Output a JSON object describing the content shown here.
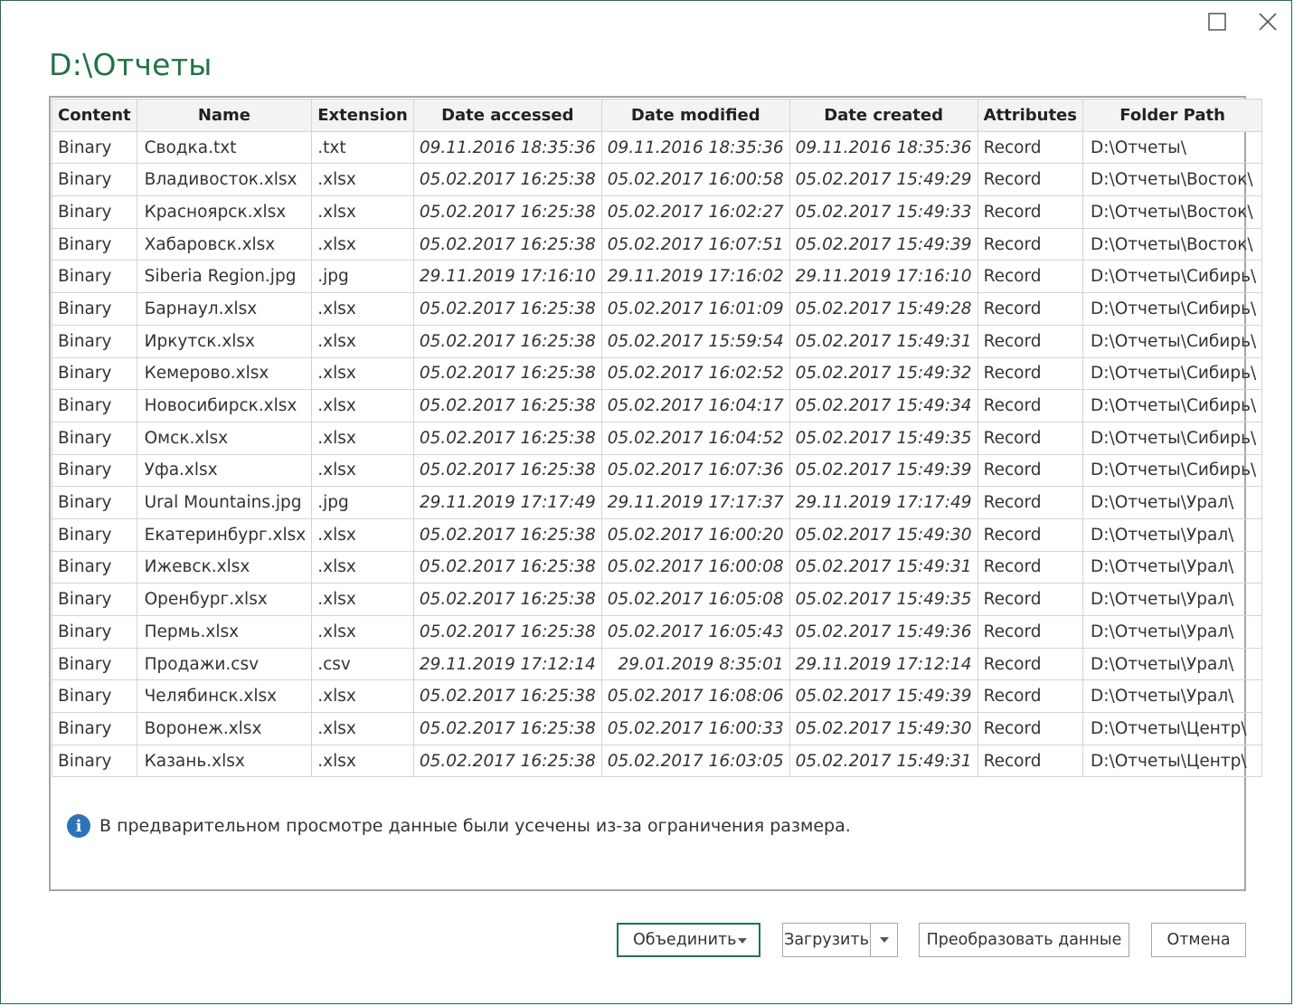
{
  "window": {
    "title": "D:\\Отчеты"
  },
  "table": {
    "columns": [
      "Content",
      "Name",
      "Extension",
      "Date accessed",
      "Date modified",
      "Date created",
      "Attributes",
      "Folder Path"
    ],
    "rows": [
      [
        "Binary",
        "Сводка.txt",
        ".txt",
        "09.11.2016 18:35:36",
        "09.11.2016 18:35:36",
        "09.11.2016 18:35:36",
        "Record",
        "D:\\Отчеты\\"
      ],
      [
        "Binary",
        "Владивосток.xlsx",
        ".xlsx",
        "05.02.2017 16:25:38",
        "05.02.2017 16:00:58",
        "05.02.2017 15:49:29",
        "Record",
        "D:\\Отчеты\\Восток\\"
      ],
      [
        "Binary",
        "Красноярск.xlsx",
        ".xlsx",
        "05.02.2017 16:25:38",
        "05.02.2017 16:02:27",
        "05.02.2017 15:49:33",
        "Record",
        "D:\\Отчеты\\Восток\\"
      ],
      [
        "Binary",
        "Хабаровск.xlsx",
        ".xlsx",
        "05.02.2017 16:25:38",
        "05.02.2017 16:07:51",
        "05.02.2017 15:49:39",
        "Record",
        "D:\\Отчеты\\Восток\\"
      ],
      [
        "Binary",
        "Siberia Region.jpg",
        ".jpg",
        "29.11.2019 17:16:10",
        "29.11.2019 17:16:02",
        "29.11.2019 17:16:10",
        "Record",
        "D:\\Отчеты\\Сибирь\\"
      ],
      [
        "Binary",
        "Барнаул.xlsx",
        ".xlsx",
        "05.02.2017 16:25:38",
        "05.02.2017 16:01:09",
        "05.02.2017 15:49:28",
        "Record",
        "D:\\Отчеты\\Сибирь\\"
      ],
      [
        "Binary",
        "Иркутск.xlsx",
        ".xlsx",
        "05.02.2017 16:25:38",
        "05.02.2017 15:59:54",
        "05.02.2017 15:49:31",
        "Record",
        "D:\\Отчеты\\Сибирь\\"
      ],
      [
        "Binary",
        "Кемерово.xlsx",
        ".xlsx",
        "05.02.2017 16:25:38",
        "05.02.2017 16:02:52",
        "05.02.2017 15:49:32",
        "Record",
        "D:\\Отчеты\\Сибирь\\"
      ],
      [
        "Binary",
        "Новосибирск.xlsx",
        ".xlsx",
        "05.02.2017 16:25:38",
        "05.02.2017 16:04:17",
        "05.02.2017 15:49:34",
        "Record",
        "D:\\Отчеты\\Сибирь\\"
      ],
      [
        "Binary",
        "Омск.xlsx",
        ".xlsx",
        "05.02.2017 16:25:38",
        "05.02.2017 16:04:52",
        "05.02.2017 15:49:35",
        "Record",
        "D:\\Отчеты\\Сибирь\\"
      ],
      [
        "Binary",
        "Уфа.xlsx",
        ".xlsx",
        "05.02.2017 16:25:38",
        "05.02.2017 16:07:36",
        "05.02.2017 15:49:39",
        "Record",
        "D:\\Отчеты\\Сибирь\\"
      ],
      [
        "Binary",
        "Ural Mountains.jpg",
        ".jpg",
        "29.11.2019 17:17:49",
        "29.11.2019 17:17:37",
        "29.11.2019 17:17:49",
        "Record",
        "D:\\Отчеты\\Урал\\"
      ],
      [
        "Binary",
        "Екатеринбург.xlsx",
        ".xlsx",
        "05.02.2017 16:25:38",
        "05.02.2017 16:00:20",
        "05.02.2017 15:49:30",
        "Record",
        "D:\\Отчеты\\Урал\\"
      ],
      [
        "Binary",
        "Ижевск.xlsx",
        ".xlsx",
        "05.02.2017 16:25:38",
        "05.02.2017 16:00:08",
        "05.02.2017 15:49:31",
        "Record",
        "D:\\Отчеты\\Урал\\"
      ],
      [
        "Binary",
        "Оренбург.xlsx",
        ".xlsx",
        "05.02.2017 16:25:38",
        "05.02.2017 16:05:08",
        "05.02.2017 15:49:35",
        "Record",
        "D:\\Отчеты\\Урал\\"
      ],
      [
        "Binary",
        "Пермь.xlsx",
        ".xlsx",
        "05.02.2017 16:25:38",
        "05.02.2017 16:05:43",
        "05.02.2017 15:49:36",
        "Record",
        "D:\\Отчеты\\Урал\\"
      ],
      [
        "Binary",
        "Продажи.csv",
        ".csv",
        "29.11.2019 17:12:14",
        "29.01.2019 8:35:01",
        "29.11.2019 17:12:14",
        "Record",
        "D:\\Отчеты\\Урал\\"
      ],
      [
        "Binary",
        "Челябинск.xlsx",
        ".xlsx",
        "05.02.2017 16:25:38",
        "05.02.2017 16:08:06",
        "05.02.2017 15:49:39",
        "Record",
        "D:\\Отчеты\\Урал\\"
      ],
      [
        "Binary",
        "Воронеж.xlsx",
        ".xlsx",
        "05.02.2017 16:25:38",
        "05.02.2017 16:00:33",
        "05.02.2017 15:49:30",
        "Record",
        "D:\\Отчеты\\Центр\\"
      ],
      [
        "Binary",
        "Казань.xlsx",
        ".xlsx",
        "05.02.2017 16:25:38",
        "05.02.2017 16:03:05",
        "05.02.2017 15:49:31",
        "Record",
        "D:\\Отчеты\\Центр\\"
      ]
    ]
  },
  "info": {
    "icon": "info-icon",
    "text": "В предварительном просмотре данные были усечены из-за ограничения размера."
  },
  "buttons": {
    "combine": "Объединить",
    "load": "Загрузить",
    "transform": "Преобразовать данные",
    "cancel": "Отмена"
  },
  "colors": {
    "accent": "#217346",
    "info": "#2e73b8",
    "header_bg": "#f3f3f3"
  }
}
